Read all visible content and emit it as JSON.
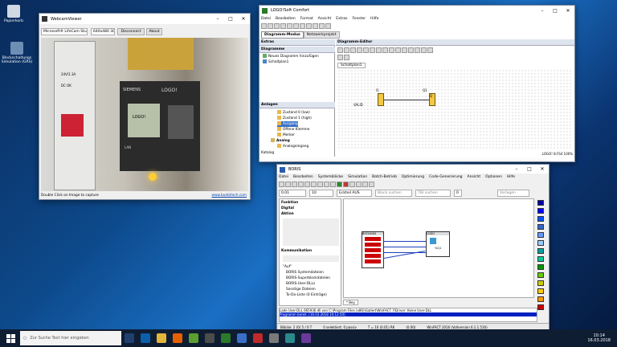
{
  "desktop": {
    "icons": [
      {
        "label": "Papierkorb"
      },
      {
        "label": "Blockschaltungs Simulation (GRS)"
      }
    ]
  },
  "webcam": {
    "title": "WebcamViewer",
    "device": "Microsoft® LifeCam Stud…",
    "resolution": "640x480 30",
    "disconnect_label": "Disconnect",
    "about_label": "About",
    "status": "Double Click on Image to capture",
    "link": "www.buetztech.com",
    "psu_text": "24V/1.3A",
    "dc_ok": "DC OK",
    "logo_screen": "LOGO!",
    "brand": "SIEMENS",
    "logo_brand": "LOGO!",
    "port": "LAN"
  },
  "logosoft": {
    "title": "LOGO!Soft Comfort",
    "menu": [
      "Datei",
      "Bearbeiten",
      "Format",
      "Ansicht",
      "Extras",
      "Fenster",
      "Hilfe"
    ],
    "tabs": [
      "Diagramm-Modus",
      "Netzwerkprojekt"
    ],
    "left_header": "Extras",
    "diagram_header": "Diagramme",
    "tree": [
      "Neues Diagramm hinzufügen",
      "Schaltplan1"
    ],
    "editor_header": "Diagramm-Editor",
    "editor_tab": "Schaltplan1",
    "block1_label": "I1",
    "block2_label": "Q1",
    "block2_name": "Q",
    "input_label": "VALID",
    "connections_header": "Anlagen",
    "connections": [
      "Zustand 0 (low)",
      "Zustand 1 (high)",
      "Ausgang",
      "Offene Klemme",
      "Merker",
      "Analog",
      "Analogeingang"
    ],
    "catalog_label": "Katalog",
    "status_right": "LOGO! 8.FS4 100%"
  },
  "boris": {
    "title": "BORIS",
    "menu": [
      "Datei",
      "Bearbeiten",
      "Systemblöcke",
      "Simulation",
      "Batch-Betrieb",
      "Optimierung",
      "Code-Generierung",
      "Ansicht",
      "Optionen",
      "Hilfe"
    ],
    "field_a": "0.01",
    "field_b": "10",
    "field_c": "Eckteil AUS",
    "field_d": "Block suchen",
    "field_e": "TIB suchen",
    "field_f": "0",
    "field_g": "Vorlagen",
    "left_sections": [
      "Funktion",
      "Digital",
      "Aktion",
      "Kommunikation"
    ],
    "tree": [
      "\"Auf\"",
      "BORIS Systemdateien",
      "BORIS-Superblockdateien",
      "BORIS-User-DLLs",
      "Sonstige Dateien",
      "To-Do-Liste (0 Einträge)"
    ],
    "block_left_title": "BOOLEAN",
    "block_right_title": "LOGO",
    "block_right_text": "%Q1",
    "canvas_tab": "* Bey",
    "log_line": "Lade User-DLL 665936.dll von C:\\Program Files (x86)\\Gallert\\WinFACT 7\\Driver: Keine User-DLL",
    "log_sel": "Programm bereit. [16.03.2018 10:12:50]",
    "status": [
      "Blöcke: 2 (0) 5 / 0 T",
      "0 selektiert: 0 passiv",
      "T = 10 (0.01) RK",
      "(0.00)",
      "WinFACT 2016 (Vollversion 6.1.1.516)"
    ],
    "colors": [
      "#0000a0",
      "#0000ff",
      "#0055ff",
      "#3366cc",
      "#6699ff",
      "#99ccff",
      "#00a0a0",
      "#00cc99",
      "#009900",
      "#66cc00",
      "#cccc00",
      "#ffcc00",
      "#ff9900",
      "#ff3300",
      "#cc0000",
      "#990033",
      "#cc00cc",
      "#660099",
      "#333333",
      "#999999"
    ]
  },
  "taskbar": {
    "search_placeholder": "Zur Suche Text hier eingeben",
    "time": "10:14",
    "date": "16.03.2018"
  }
}
